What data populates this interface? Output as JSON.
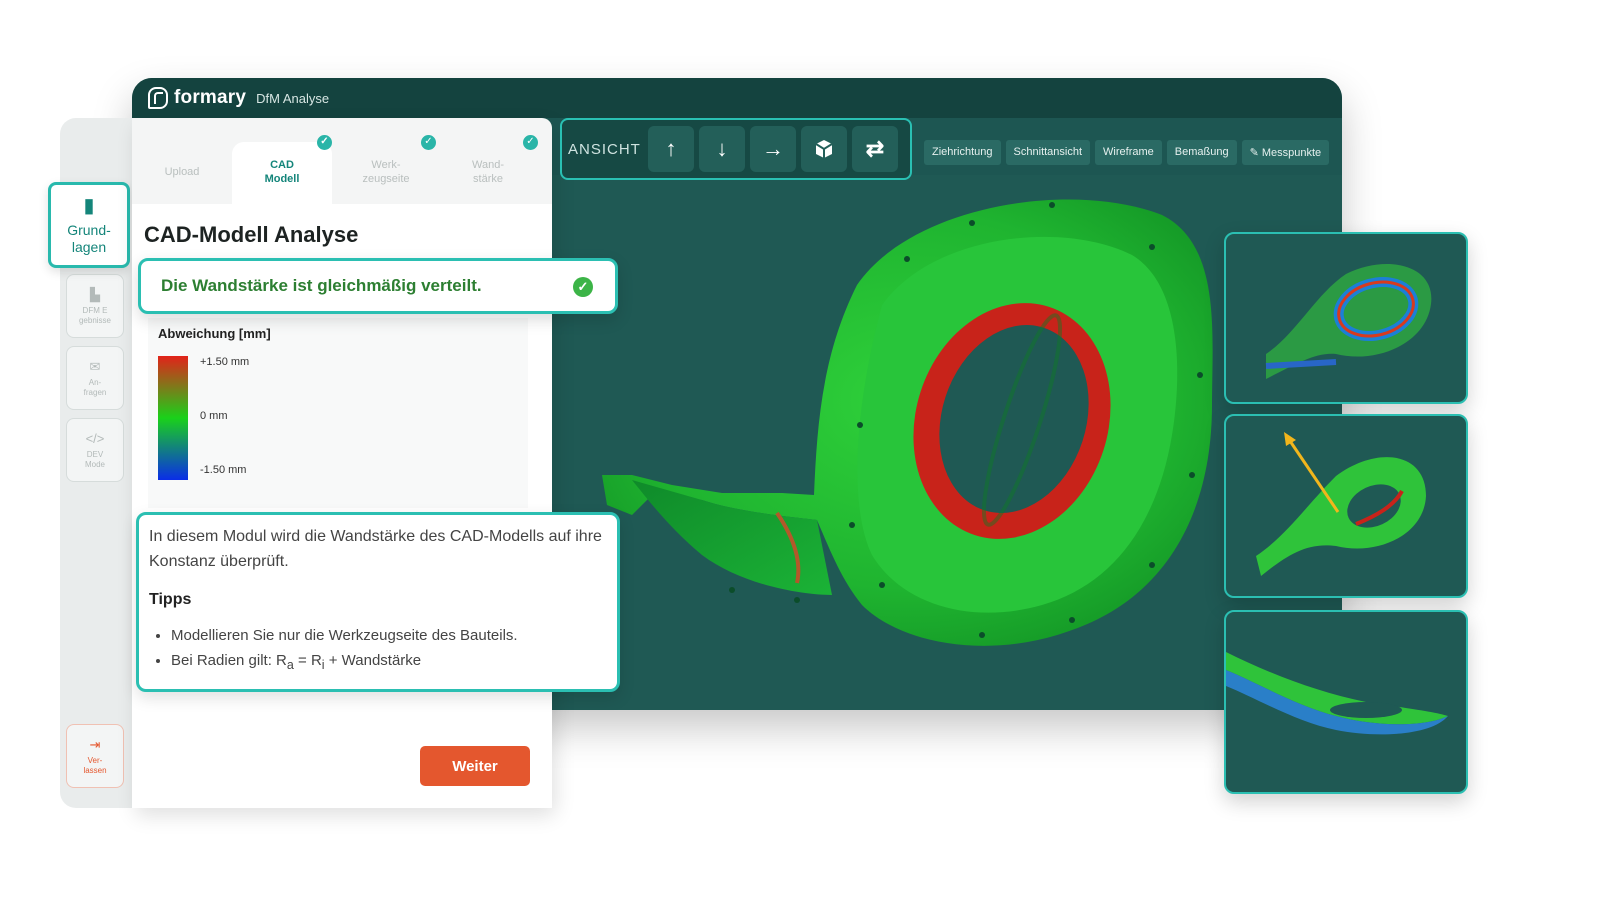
{
  "header": {
    "brand": "formary",
    "subtitle": "DfM Analyse"
  },
  "toolbar": {
    "ansicht_label": "ANSICHT",
    "view_buttons": [
      {
        "icon": "arrow-up-icon"
      },
      {
        "icon": "arrow-down-icon"
      },
      {
        "icon": "arrow-right-icon"
      },
      {
        "icon": "cube-icon"
      },
      {
        "icon": "swap-icon"
      }
    ],
    "chips": [
      "Ziehrichtung",
      "Schnittansicht",
      "Wireframe",
      "Bemaßung",
      "Messpunkte"
    ]
  },
  "sidebar": {
    "items": [
      {
        "label": "Grund-\nlagen",
        "icon": "document-upload-icon",
        "active": true
      },
      {
        "label": "DFM E\ngebnisse",
        "icon": "chart-icon"
      },
      {
        "label": "An-\nfragen",
        "icon": "mail-icon"
      },
      {
        "label": "DEV\nMode",
        "icon": "code-icon"
      }
    ],
    "exit": {
      "label": "Ver-\nlassen",
      "icon": "logout-icon"
    }
  },
  "tabs": [
    {
      "label": "Upload",
      "done": false
    },
    {
      "label": "CAD\nModell",
      "done": true,
      "active": true
    },
    {
      "label": "Werk-\nzeugseite",
      "done": true
    },
    {
      "label": "Wand-\nstärke",
      "done": true
    }
  ],
  "panel": {
    "title": "CAD-Modell Analyse",
    "alert": "Die Wandstärke ist gleichmäßig verteilt.",
    "legend": {
      "title": "Abweichung [mm]",
      "max": "+1.50 mm",
      "mid": "0 mm",
      "min": "-1.50 mm"
    },
    "info": {
      "description": "In diesem Modul wird die Wandstärke des CAD-Modells auf ihre Konstanz überprüft.",
      "tips_title": "Tipps",
      "tip1": "Modellieren Sie nur die Werkzeugseite des Bauteils.",
      "tip2_prefix": "Bei Radien gilt: R",
      "tip2_sub_a": "a",
      "tip2_mid": " = R",
      "tip2_sub_i": "i",
      "tip2_suffix": " + Wandstärke"
    },
    "next_button": "Weiter"
  },
  "colors": {
    "accent": "#2bbfb2",
    "app_bg": "#1d5652",
    "cta": "#e4572e",
    "ok_green": "#3cb447"
  }
}
